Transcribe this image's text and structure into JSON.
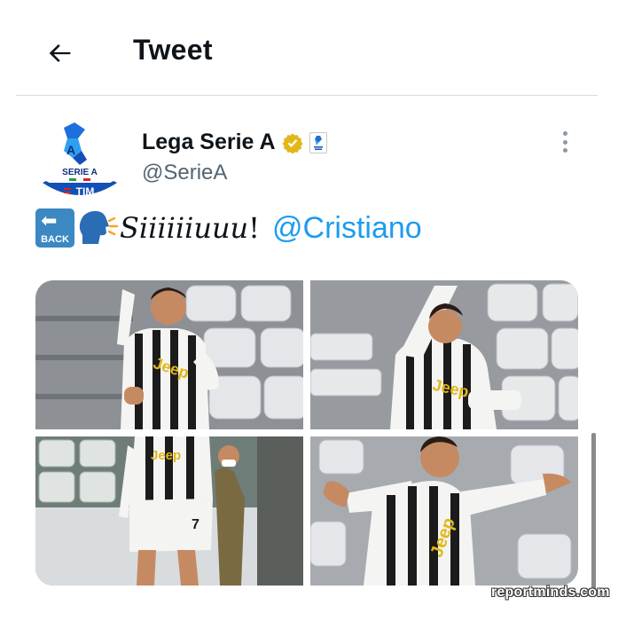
{
  "header": {
    "title": "Tweet",
    "back_icon": "arrow-left-icon"
  },
  "tweet": {
    "author": {
      "display_name": "Lega Serie A",
      "handle": "@SerieA",
      "avatar_text_top": "SERIE A",
      "avatar_text_bottom": "TIM",
      "verified_icon": "verified-badge-icon",
      "affiliate_icon": "serie-a-logo-icon"
    },
    "text": {
      "emoji_back_label": "BACK",
      "emoji_head_icon": "speaking-head-icon",
      "body": "Siiiiiiuuu",
      "exclamation": "!",
      "mention": "@Cristiano"
    },
    "media_count": 4,
    "more_icon": "more-options-icon"
  },
  "watermark": "reportminds.com",
  "colors": {
    "link": "#1d9bf0",
    "verified": "#e2b719",
    "secondary_text": "#536471",
    "logo_blue": "#1a6fd9"
  }
}
